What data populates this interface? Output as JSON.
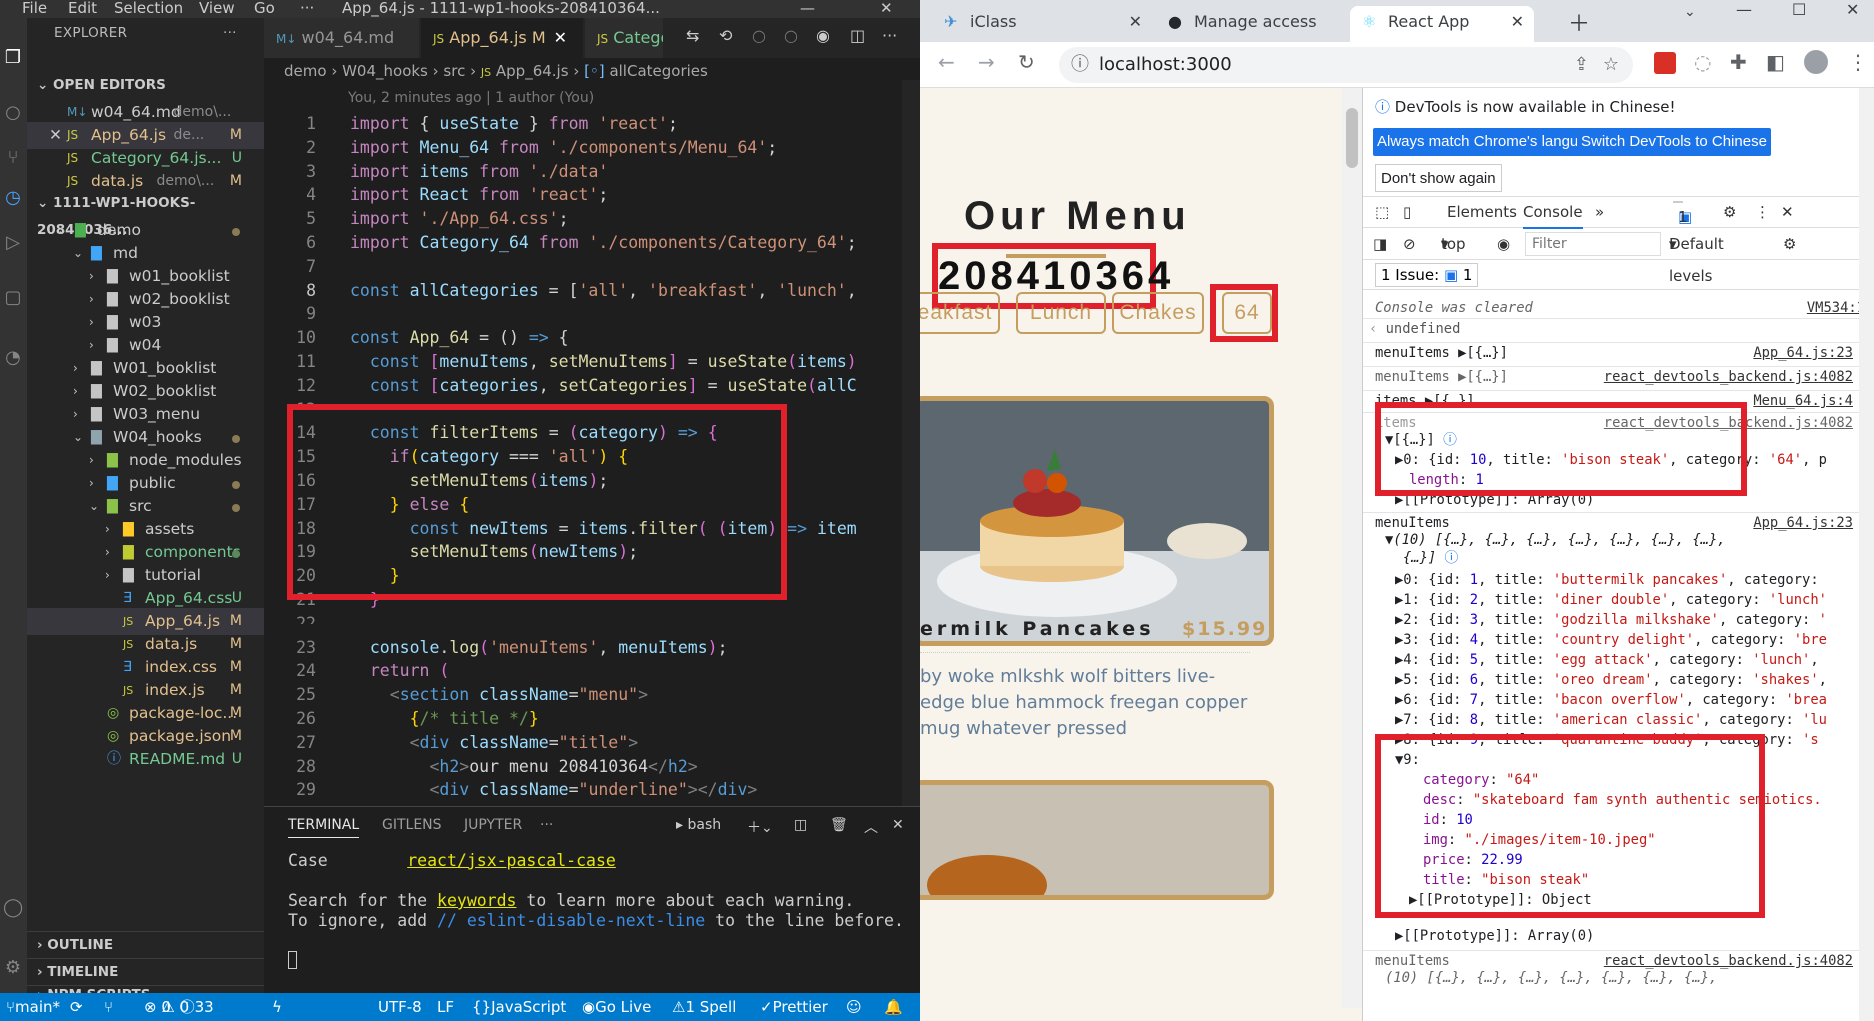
{
  "vscode": {
    "menu": [
      "File",
      "Edit",
      "Selection",
      "View",
      "Go",
      "···"
    ],
    "window_title": "App_64.js - 1111-wp1-hooks-208410364...",
    "explorer_label": "EXPLORER",
    "open_editors_label": "OPEN EDITORS",
    "open_editors": [
      {
        "name": "w04_64.md",
        "path": "demo\\...",
        "status": ""
      },
      {
        "name": "App_64.js",
        "path": "de...",
        "status": "M"
      },
      {
        "name": "Category_64.js...",
        "path": "",
        "status": "U"
      },
      {
        "name": "data.js",
        "path": "demo\\...",
        "status": "M"
      }
    ],
    "project_label": "1111-WP1-HOOKS-20841036...",
    "tree": [
      {
        "name": "demo",
        "depth": 1,
        "type": "folder-open",
        "status": "dot"
      },
      {
        "name": "md",
        "depth": 2,
        "type": "folder-open",
        "status": ""
      },
      {
        "name": "w01_booklist",
        "depth": 3,
        "type": "folder",
        "status": ""
      },
      {
        "name": "w02_booklist",
        "depth": 3,
        "type": "folder",
        "status": ""
      },
      {
        "name": "w03",
        "depth": 3,
        "type": "folder",
        "status": ""
      },
      {
        "name": "w04",
        "depth": 3,
        "type": "folder",
        "status": ""
      },
      {
        "name": "W01_booklist",
        "depth": 2,
        "type": "folder",
        "status": ""
      },
      {
        "name": "W02_booklist",
        "depth": 2,
        "type": "folder",
        "status": ""
      },
      {
        "name": "W03_menu",
        "depth": 2,
        "type": "folder",
        "status": ""
      },
      {
        "name": "W04_hooks",
        "depth": 2,
        "type": "folder-open",
        "status": "dot"
      },
      {
        "name": "node_modules",
        "depth": 3,
        "type": "folder",
        "status": ""
      },
      {
        "name": "public",
        "depth": 3,
        "type": "folder",
        "status": "dot"
      },
      {
        "name": "src",
        "depth": 3,
        "type": "folder-open",
        "status": "dot"
      },
      {
        "name": "assets",
        "depth": 4,
        "type": "folder",
        "status": ""
      },
      {
        "name": "components",
        "depth": 4,
        "type": "folder",
        "status": "dotg"
      },
      {
        "name": "tutorial",
        "depth": 4,
        "type": "folder",
        "status": ""
      },
      {
        "name": "App_64.css",
        "depth": 4,
        "type": "css",
        "status": "U"
      },
      {
        "name": "App_64.js",
        "depth": 4,
        "type": "js",
        "status": "M"
      },
      {
        "name": "data.js",
        "depth": 4,
        "type": "js",
        "status": "M"
      },
      {
        "name": "index.css",
        "depth": 4,
        "type": "css",
        "status": "M"
      },
      {
        "name": "index.js",
        "depth": 4,
        "type": "js",
        "status": "M"
      },
      {
        "name": "package-loc...",
        "depth": 3,
        "type": "json",
        "status": "M"
      },
      {
        "name": "package.json",
        "depth": 3,
        "type": "json",
        "status": "M"
      },
      {
        "name": "README.md",
        "depth": 3,
        "type": "md",
        "status": "U"
      }
    ],
    "bottom_sections": [
      "OUTLINE",
      "TIMELINE",
      "NPM SCRIPTS"
    ],
    "tabs": [
      {
        "label": "w04_64.md",
        "prefix": "M↓"
      },
      {
        "label": "App_64.js M",
        "prefix": "JS"
      },
      {
        "label": "Catego",
        "prefix": "JS"
      }
    ],
    "breadcrumb": [
      "demo",
      "W04_hooks",
      "src",
      "App_64.js",
      "allCategories"
    ],
    "blame": "You, 2 minutes ago | 1 author (You)",
    "line_numbers": [
      "1",
      "2",
      "3",
      "4",
      "5",
      "6",
      "7",
      "8",
      "9",
      "10",
      "11",
      "12",
      "13",
      "14",
      "15",
      "16",
      "17",
      "18",
      "19",
      "20",
      "21",
      "22",
      "23",
      "24",
      "25",
      "26",
      "27",
      "28",
      "29"
    ],
    "terminal": {
      "tabs": [
        "TERMINAL",
        "GITLENS",
        "JUPYTER",
        "···"
      ],
      "shell": "bash",
      "line1_a": "Case        ",
      "line1_link": "react/jsx-pascal-case",
      "line2": "Search for the ",
      "line2_kw": "keywords",
      "line2_rest": " to learn more about each warning.",
      "line3": "To ignore, add ",
      "line3_cm": "// eslint-disable-next-line",
      "line3_rest": " to the line before."
    },
    "status": {
      "branch": "main*",
      "errors": "0",
      "warnings": "0",
      "info": "33",
      "encoding": "UTF-8",
      "eol": "LF",
      "language": "JavaScript",
      "golive": "Go Live",
      "spell": "1 Spell",
      "prettier": "Prettier"
    }
  },
  "chrome": {
    "tabs": [
      {
        "label": "iClass"
      },
      {
        "label": "Manage access"
      },
      {
        "label": "React App"
      }
    ],
    "url": "localhost:3000",
    "page": {
      "title": "Our Menu",
      "id": "208410364",
      "categories": [
        "eakfast",
        "Lunch",
        "Chakes",
        "64"
      ],
      "item_name": "ermilk Pancakes",
      "item_price": "$15.99",
      "item_desc": "by woke mlkshk wolf bitters live-edge blue hammock freegan copper mug whatever pressed"
    },
    "devtools": {
      "info": "DevTools is now available in Chinese!",
      "btn_match": "Always match Chrome's language",
      "btn_switch": "Switch DevTools to Chinese",
      "btn_dont": "Don't show again",
      "tabs": [
        "Elements",
        "Console",
        "»"
      ],
      "badge": "1",
      "context": "top",
      "filter_placeholder": "Filter",
      "levels": "Default levels",
      "issues": "1 Issue:",
      "issue_count": "1",
      "console_cleared": "Console was cleared",
      "vm": "VM534:1",
      "undefined": "undefined",
      "log_menu1": "menuItems",
      "src_app23": "App_64.js:23",
      "src_backend": "react_devtools_backend.js:4082",
      "log_items": "items",
      "src_menu4": "Menu_64.js:4"
    }
  }
}
